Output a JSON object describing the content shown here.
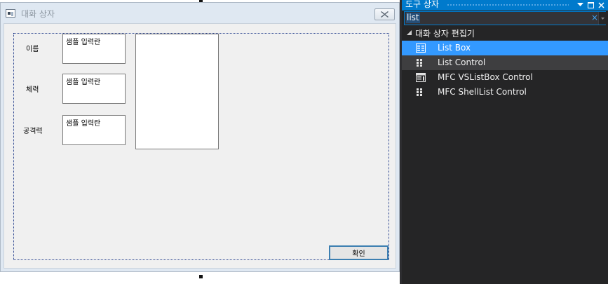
{
  "dialog": {
    "title": "대화 상자",
    "fields": [
      {
        "label": "이름",
        "value": "샘플 입력란"
      },
      {
        "label": "체력",
        "value": "샘플 입력란"
      },
      {
        "label": "공격력",
        "value": "샘플 입력란"
      }
    ],
    "ok_label": "확인"
  },
  "toolbox": {
    "title": "도구 상자",
    "search_value": "list",
    "clear_glyph": "×",
    "group_label": "대화 상자 편집기",
    "items": [
      {
        "label": "List Box",
        "icon": "listbox-icon",
        "state": "selected"
      },
      {
        "label": "List Control",
        "icon": "list-control-icon",
        "state": "hover"
      },
      {
        "label": "MFC VSListBox Control",
        "icon": "vslistbox-icon",
        "state": "normal"
      },
      {
        "label": "MFC ShellList Control",
        "icon": "shelllist-icon",
        "state": "normal"
      }
    ]
  },
  "colors": {
    "accent": "#007acc",
    "selection": "#3399ff",
    "panel_bg": "#252526"
  }
}
